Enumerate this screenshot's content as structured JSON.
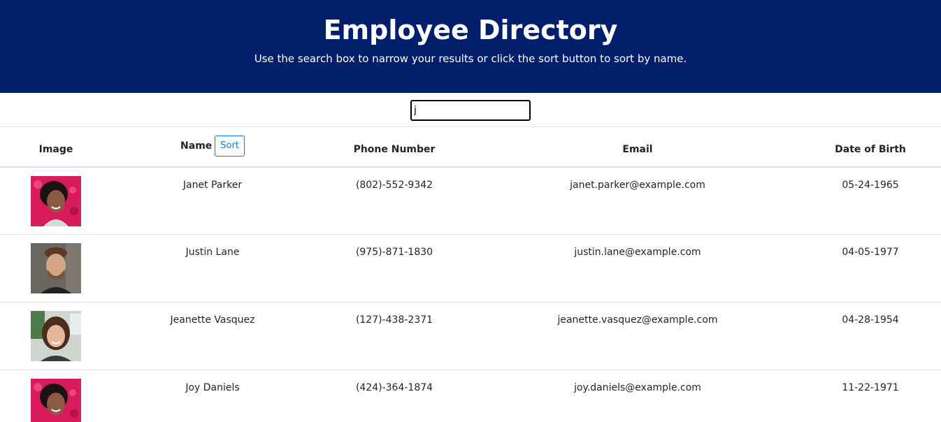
{
  "header": {
    "title": "Employee Directory",
    "subtitle": "Use the search box to narrow your results or click the sort button to sort by name."
  },
  "search": {
    "value": "j",
    "placeholder": ""
  },
  "table": {
    "columns": {
      "image": "Image",
      "name": "Name",
      "sort_label": "Sort",
      "phone": "Phone Number",
      "email": "Email",
      "dob": "Date of Birth"
    },
    "rows": [
      {
        "name": "Janet Parker",
        "phone": "(802)-552-9342",
        "email": "janet.parker@example.com",
        "dob": "05-24-1965",
        "avatar_icon": "woman-avatar-pink",
        "avatar_bg": "#d81b5a"
      },
      {
        "name": "Justin Lane",
        "phone": "(975)-871-1830",
        "email": "justin.lane@example.com",
        "dob": "04-05-1977",
        "avatar_icon": "man-avatar-gray",
        "avatar_bg": "#6b6660"
      },
      {
        "name": "Jeanette Vasquez",
        "phone": "(127)-438-2371",
        "email": "jeanette.vasquez@example.com",
        "dob": "04-28-1954",
        "avatar_icon": "woman-avatar-light",
        "avatar_bg": "#cfd6cf"
      },
      {
        "name": "Joy Daniels",
        "phone": "(424)-364-1874",
        "email": "joy.daniels@example.com",
        "dob": "11-22-1971",
        "avatar_icon": "woman-avatar-pink",
        "avatar_bg": "#d81b5a"
      }
    ]
  },
  "colors": {
    "header_bg": "#031e6b",
    "accent": "#007bff"
  }
}
